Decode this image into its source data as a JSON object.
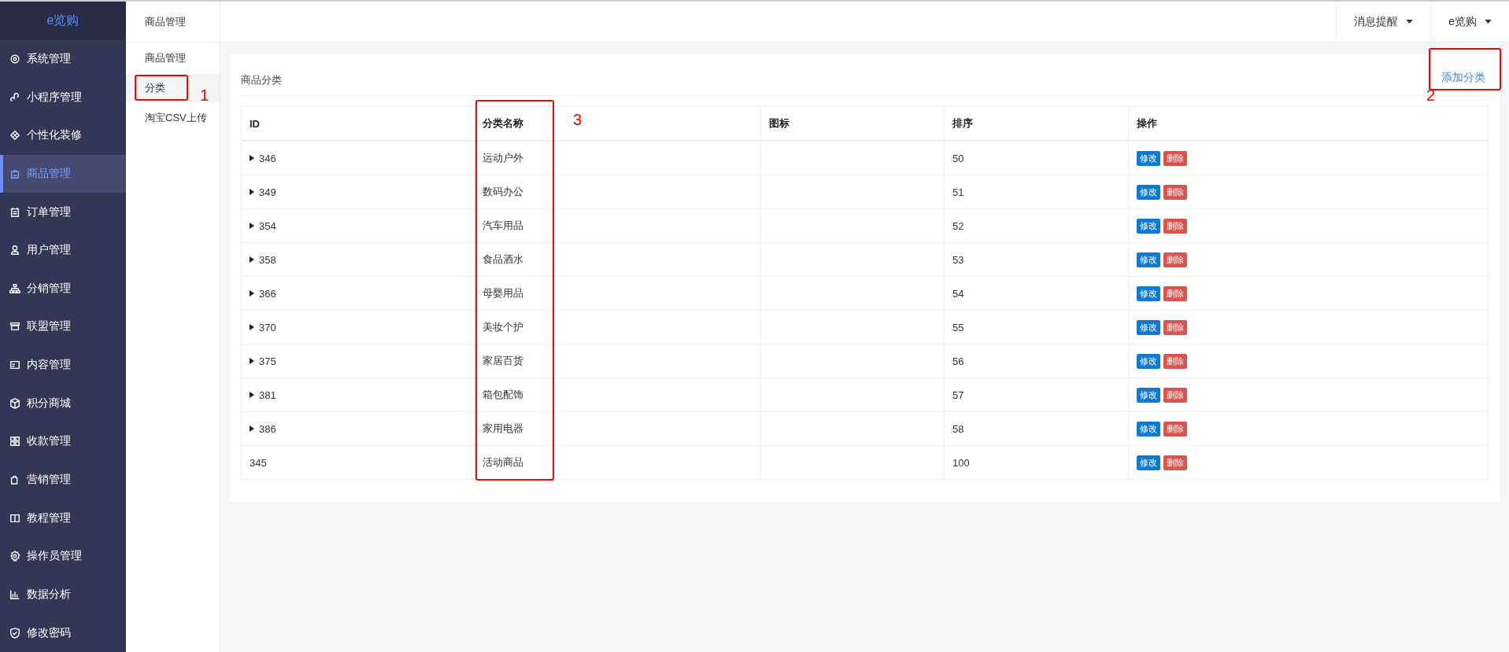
{
  "sidebar": {
    "logo": "e览购",
    "items": [
      {
        "label": "系统管理",
        "selected": false
      },
      {
        "label": "小程序管理",
        "selected": false
      },
      {
        "label": "个性化装修",
        "selected": false
      },
      {
        "label": "商品管理",
        "selected": true
      },
      {
        "label": "订单管理",
        "selected": false
      },
      {
        "label": "用户管理",
        "selected": false
      },
      {
        "label": "分销管理",
        "selected": false
      },
      {
        "label": "联盟管理",
        "selected": false
      },
      {
        "label": "内容管理",
        "selected": false
      },
      {
        "label": "积分商城",
        "selected": false
      },
      {
        "label": "收款管理",
        "selected": false
      },
      {
        "label": "营销管理",
        "selected": false
      },
      {
        "label": "教程管理",
        "selected": false
      },
      {
        "label": "操作员管理",
        "selected": false
      },
      {
        "label": "数据分析",
        "selected": false
      },
      {
        "label": "修改密码",
        "selected": false
      }
    ]
  },
  "subnav": {
    "title": "商品管理",
    "items": [
      {
        "label": "商品管理",
        "selected": false
      },
      {
        "label": "分类",
        "selected": true
      },
      {
        "label": "淘宝CSV上传",
        "selected": false
      }
    ]
  },
  "header": {
    "menus": [
      "消息提醒",
      "e览购"
    ]
  },
  "card": {
    "title": "商品分类",
    "add_link": "添加分类"
  },
  "table": {
    "columns": [
      "ID",
      "分类名称",
      "图标",
      "排序",
      "操作"
    ],
    "rows": [
      {
        "id": "346",
        "name": "运动户外",
        "sort": "50",
        "expandable": true,
        "actions": [
          "修改",
          "删除"
        ]
      },
      {
        "id": "349",
        "name": "数码办公",
        "sort": "51",
        "expandable": true,
        "actions": [
          "修改",
          "删除"
        ]
      },
      {
        "id": "354",
        "name": "汽车用品",
        "sort": "52",
        "expandable": true,
        "actions": [
          "修改",
          "删除"
        ]
      },
      {
        "id": "358",
        "name": "食品酒水",
        "sort": "53",
        "expandable": true,
        "actions": [
          "修改",
          "删除"
        ]
      },
      {
        "id": "366",
        "name": "母婴用品",
        "sort": "54",
        "expandable": true,
        "actions": [
          "修改",
          "删除"
        ]
      },
      {
        "id": "370",
        "name": "美妆个护",
        "sort": "55",
        "expandable": true,
        "actions": [
          "修改",
          "删除"
        ]
      },
      {
        "id": "375",
        "name": "家居百货",
        "sort": "56",
        "expandable": true,
        "actions": [
          "修改",
          "删除"
        ]
      },
      {
        "id": "381",
        "name": "箱包配饰",
        "sort": "57",
        "expandable": true,
        "actions": [
          "修改",
          "删除"
        ]
      },
      {
        "id": "386",
        "name": "家用电器",
        "sort": "58",
        "expandable": true,
        "actions": [
          "修改",
          "删除"
        ]
      },
      {
        "id": "345",
        "name": "活动商品",
        "sort": "100",
        "expandable": false,
        "actions": [
          "修改",
          "删除"
        ]
      }
    ]
  },
  "annotations": [
    {
      "label": "1"
    },
    {
      "label": "2"
    },
    {
      "label": "3"
    }
  ]
}
